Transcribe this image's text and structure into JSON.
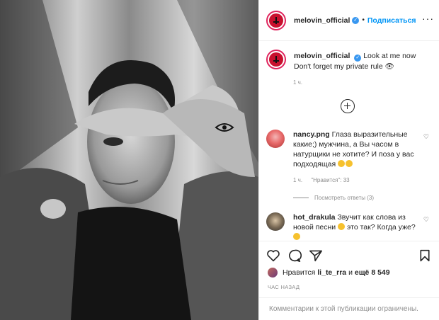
{
  "header": {
    "username": "melovin_official",
    "verified_mark": "✓",
    "separator": "•",
    "follow_label": "Подписаться",
    "more_icon": "more-horizontal-icon"
  },
  "caption": {
    "username": "melovin_official",
    "verified_mark": "✓",
    "line1": "Look at me now",
    "line2": "Don't forget my private rule 👁",
    "time": "1 ч."
  },
  "load_more_icon": "plus-circle-icon",
  "comments": [
    {
      "username": "nancy.png",
      "text": "Глаза выразительные какие;) мужчина, а Вы часом в натурщики не хотите? И поза у вас подходящая",
      "time": "1 ч.",
      "likes": "\"Нравится\": 33",
      "replies": "Посмотреть ответы (3)"
    },
    {
      "username": "hot_drakula",
      "text": "Звучит как слова из новой песни",
      "text2": "это так? Когда уже?"
    }
  ],
  "actions": {
    "like_icon": "heart-icon",
    "comment_icon": "comment-icon",
    "share_icon": "paper-plane-icon",
    "save_icon": "bookmark-icon"
  },
  "likes": {
    "prefix": "Нравится",
    "user": "li_te_rra",
    "connector": "и",
    "count": "ещё 8 549"
  },
  "posted_ago": "ЧАС НАЗАД",
  "comments_limited": "Комментарии к этой публикации ограничены."
}
